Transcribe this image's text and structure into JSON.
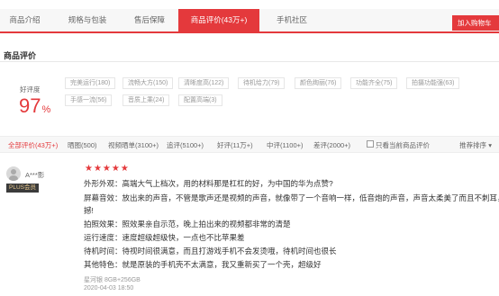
{
  "tabs": [
    "商品介绍",
    "规格与包装",
    "售后保障",
    "商品评价(43万+)",
    "手机社区"
  ],
  "cart_button": "加入购物车",
  "section_title": "商品评价",
  "good_rate": {
    "label": "好评度",
    "value": "97",
    "unit": "%"
  },
  "tags": [
    "完美运行(180)",
    "流畅大方(150)",
    "清晰度高(122)",
    "待机给力(79)",
    "颜色绚丽(76)",
    "功能齐全(75)",
    "拍摄功能强(63)",
    "手感一流(56)",
    "音质上乘(24)",
    "配置高端(3)"
  ],
  "filters": [
    "全部评价(43万+)",
    "晒图(500)",
    "视频晒单(3100+)",
    "追评(5100+)",
    "好评(11万+)",
    "中评(1100+)",
    "差评(2000+)",
    "只看当前商品评价"
  ],
  "sort_label": "推荐排序 ▾",
  "review": {
    "username": "A***影",
    "badge": "PLUS会员",
    "stars": "★★★★★",
    "lines": [
      "外形外观：高端大气上档次，用的材料那是杠杠的好，为中国的华为点赞?",
      "屏幕音效：放出来的声音，不管是歌声还是视频的声音，就像带了一个音响一样，低音炮的声音，声音太柔美了而且不刺耳，很震",
      "撼!",
      "拍照效果：照效果亲自示范，晚上拍出来的视频都非常的清楚",
      "运行速度：速度超级超级快，一点也不比苹果差",
      "待机时间：待视时间很满意，而且打游戏手机不会发烫哦，待机时间也很长",
      "其他特色：就是原装的手机壳不太满意，我又重新买了一个壳，超级好"
    ],
    "product_info": "星河银      8GB+256GB",
    "date": "2020-04-03 18:50"
  }
}
